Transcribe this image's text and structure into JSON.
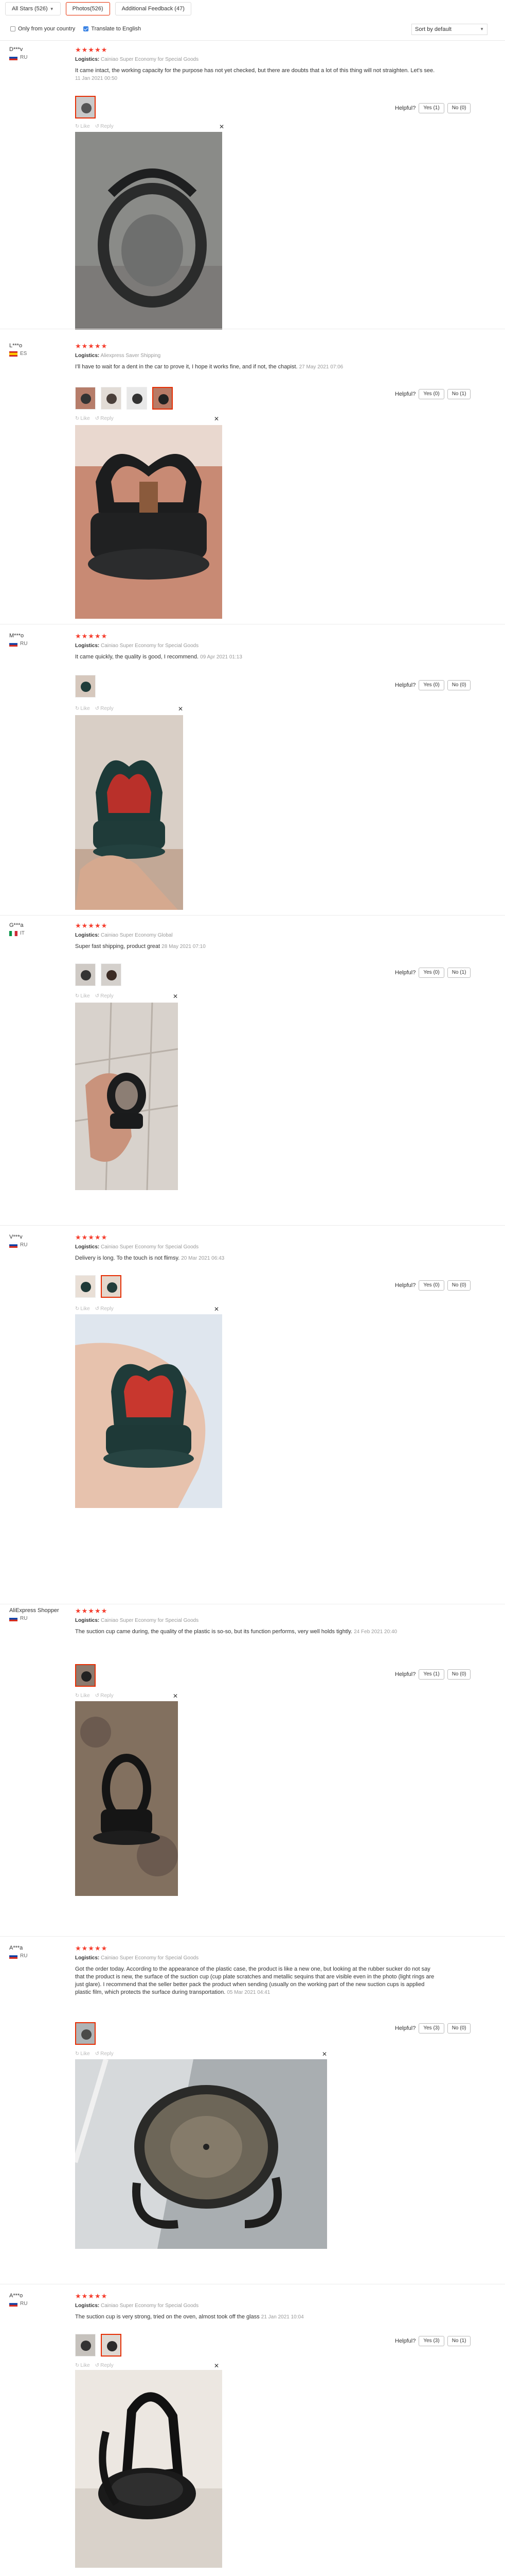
{
  "filters": {
    "all_stars": "All Stars (526)",
    "photos": "Photos(526)",
    "additional": "Additional Feedback (47)",
    "only_country": "Only from your country",
    "translate": "Translate to English",
    "sort": "Sort by default"
  },
  "vote": {
    "helpful": "Helpful?",
    "like": "Like",
    "reply": "Reply"
  },
  "reviews": [
    {
      "user": "D***v",
      "country": "RU",
      "stars": "★★★★★",
      "logistics_label": "Logistics:",
      "logistics": "Cainiao Super Economy for Special Goods",
      "text": "It came intact, the working capacity for the purpose has not yet checked, but there are doubts that a lot of this thing will not straighten. Let's see.",
      "date": "11 Jan 2021 00:50",
      "yes": "Yes (1)",
      "no": "No (0)"
    },
    {
      "user": "L***o",
      "country": "ES",
      "stars": "★★★★★",
      "logistics_label": "Logistics:",
      "logistics": "Aliexpress Saver Shipping",
      "text": "I'll have to wait for a dent in the car to prove it, I hope it works fine, and if not, the chapist.",
      "date": "27 May 2021 07:06",
      "yes": "Yes (0)",
      "no": "No (1)"
    },
    {
      "user": "M***o",
      "country": "RU",
      "stars": "★★★★★",
      "logistics_label": "Logistics:",
      "logistics": "Cainiao Super Economy for Special Goods",
      "text": "It came quickly, the quality is good, I recommend.",
      "date": "09 Apr 2021 01:13",
      "yes": "Yes (0)",
      "no": "No (0)"
    },
    {
      "user": "G***a",
      "country": "IT",
      "stars": "★★★★★",
      "logistics_label": "Logistics:",
      "logistics": "Cainiao Super Economy Global",
      "text": "Super fast shipping, product great",
      "date": "28 May 2021 07:10",
      "yes": "Yes (0)",
      "no": "No (1)"
    },
    {
      "user": "V***v",
      "country": "RU",
      "stars": "★★★★★",
      "logistics_label": "Logistics:",
      "logistics": "Cainiao Super Economy for Special Goods",
      "text": "Delivery is long. To the touch is not flimsy.",
      "date": "20 Mar 2021 06:43",
      "yes": "Yes (0)",
      "no": "No (0)"
    },
    {
      "user": "AliExpress Shopper",
      "country": "RU",
      "stars": "★★★★★",
      "logistics_label": "Logistics:",
      "logistics": "Cainiao Super Economy for Special Goods",
      "text": "The suction cup came during, the quality of the plastic is so-so, but its function performs, very well holds tightly.",
      "date": "24 Feb 2021 20:40",
      "yes": "Yes (1)",
      "no": "No (0)"
    },
    {
      "user": "A***a",
      "country": "RU",
      "stars": "★★★★★",
      "logistics_label": "Logistics:",
      "logistics": "Cainiao Super Economy for Special Goods",
      "text": "Got the order today. According to the appearance of the plastic case, the product is like a new one, but looking at the rubber sucker do not say that the product is new, the surface of the suction cup (cup plate scratches and metallic sequins that are visible even in the photo (light rings are just glare). I recommend that the seller better pack the product when sending (usually on the working part of the new suction cups is applied plastic film, which protects the surface during transportation.",
      "date": "05 Mar 2021 04:41",
      "yes": "Yes (3)",
      "no": "No (0)"
    },
    {
      "user": "A***o",
      "country": "RU",
      "stars": "★★★★★",
      "logistics_label": "Logistics:",
      "logistics": "Cainiao Super Economy for Special Goods",
      "text": "The suction cup is very strong, tried on the oven, almost took off the glass",
      "date": "21 Jan 2021 10:04",
      "yes": "Yes (3)",
      "no": "No (1)"
    }
  ]
}
